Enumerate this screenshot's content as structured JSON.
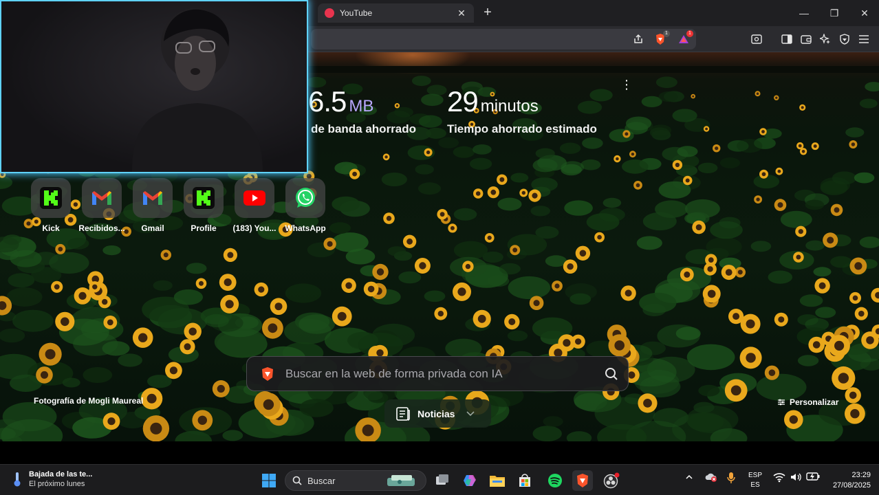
{
  "browser": {
    "tab_title": "YouTube",
    "tab_close": "✕",
    "new_tab": "+",
    "minimize": "—",
    "maximize": "❐",
    "close": "✕",
    "extension_badges": [
      "1",
      "1"
    ]
  },
  "ntp": {
    "stats": [
      {
        "value": "6.5",
        "unit": "MB",
        "label": "de banda ahorrado"
      },
      {
        "value": "29",
        "unit": "minutos",
        "label": "Tiempo ahorrado estimado"
      }
    ],
    "shortcuts": [
      {
        "label": "Kick",
        "icon": "kick-icon"
      },
      {
        "label": "Recibidos...",
        "icon": "gmail-icon"
      },
      {
        "label": "Gmail",
        "icon": "gmail-icon"
      },
      {
        "label": "Profile",
        "icon": "kick-icon"
      },
      {
        "label": "(183) You...",
        "icon": "youtube-icon"
      },
      {
        "label": "WhatsApp",
        "icon": "whatsapp-icon"
      }
    ],
    "search_placeholder": "Buscar en la web de forma privada con IA",
    "photo_credit": "Fotografía de Mogli Maureal",
    "customize": "Personalizar",
    "news": "Noticias"
  },
  "taskbar": {
    "weather_title": "Bajada de las te...",
    "weather_sub": "El próximo lunes",
    "search_label": "Buscar",
    "lang_top": "ESP",
    "lang_bottom": "ES",
    "time": "23:29",
    "date": "27/08/2025"
  },
  "colors": {
    "accent_cyan": "#5fd2ff",
    "kick_green": "#53fc18",
    "youtube_red": "#ff0000",
    "whatsapp_green": "#25d366",
    "brave_orange": "#fb542b"
  }
}
